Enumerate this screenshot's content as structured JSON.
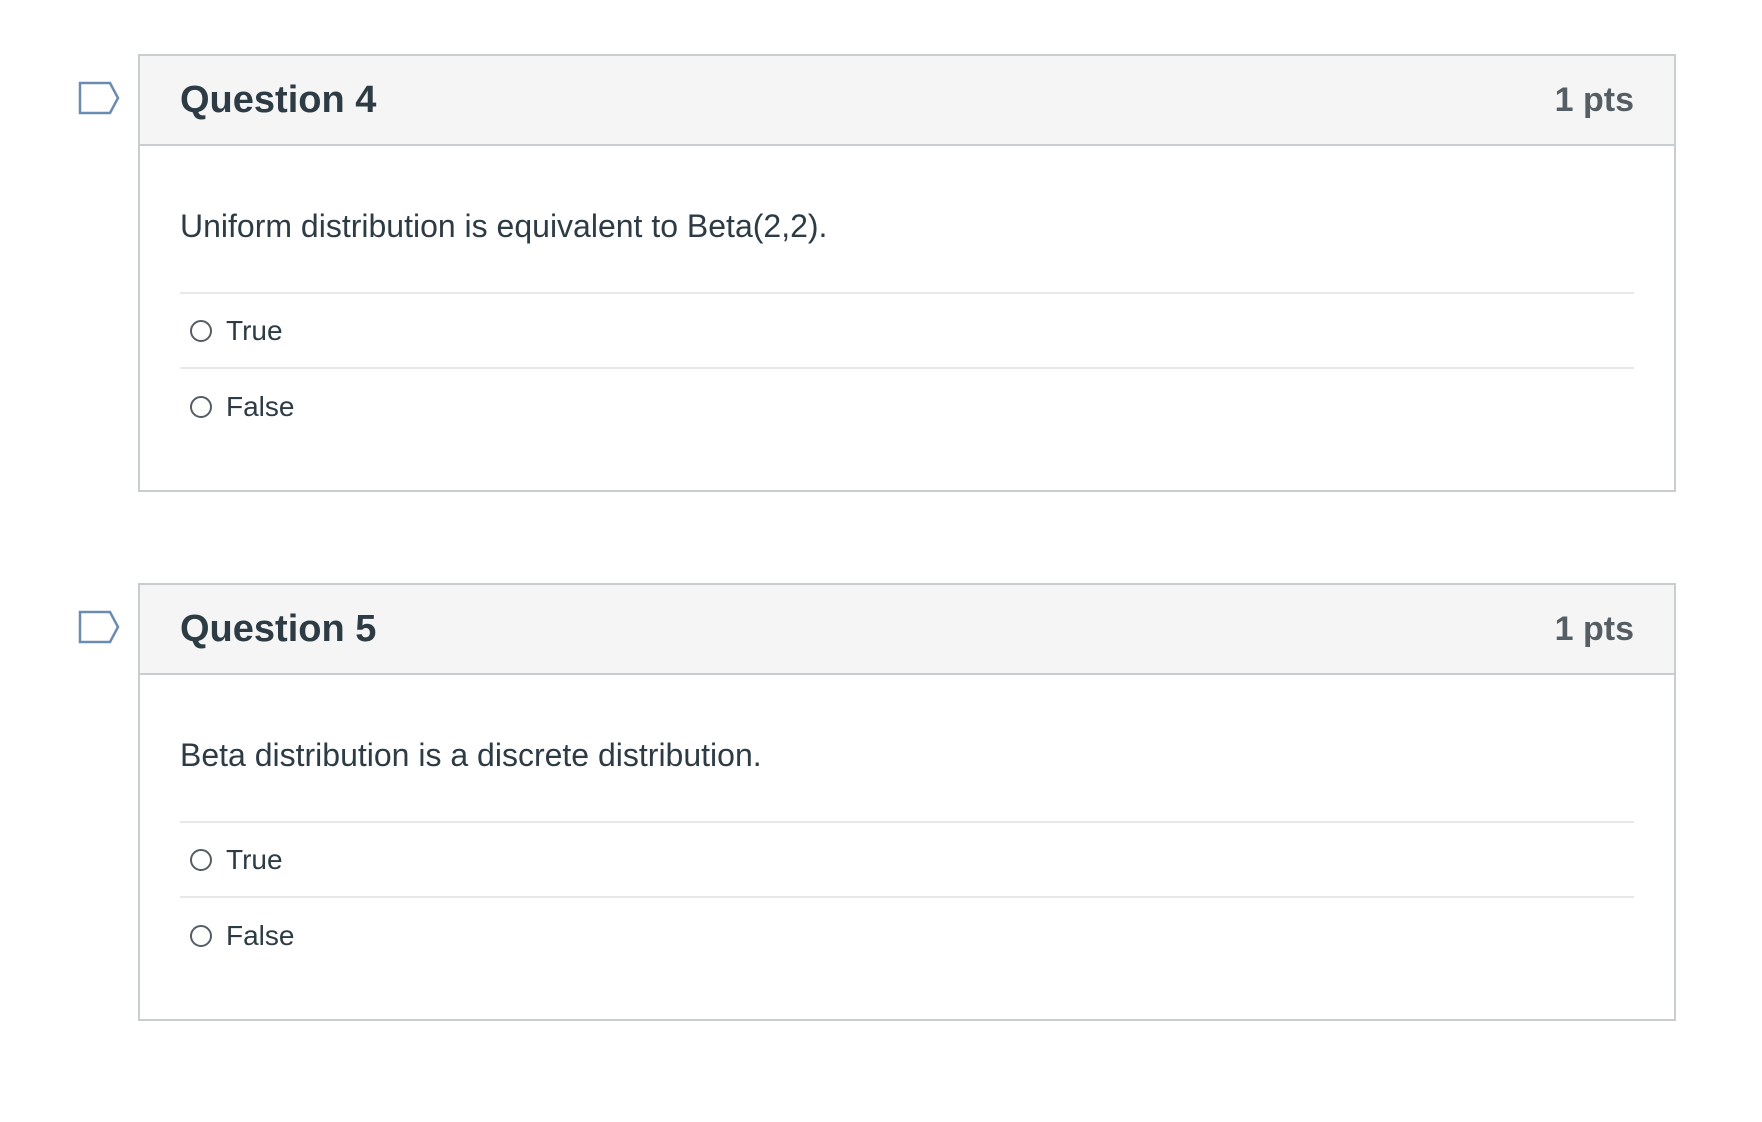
{
  "questions": [
    {
      "title": "Question 4",
      "points": "1 pts",
      "text": "Uniform distribution is equivalent to Beta(2,2).",
      "answers": [
        {
          "label": "True"
        },
        {
          "label": "False"
        }
      ]
    },
    {
      "title": "Question 5",
      "points": "1 pts",
      "text": "Beta distribution is a discrete distribution.",
      "answers": [
        {
          "label": "True"
        },
        {
          "label": "False"
        }
      ]
    }
  ],
  "icons": {
    "flag": "flag-question-icon"
  },
  "colors": {
    "flag_stroke": "#6b8bb0",
    "header_bg": "#f5f5f5",
    "border": "#c7cdd1",
    "text": "#2d3b45",
    "points_text": "#555e64"
  }
}
